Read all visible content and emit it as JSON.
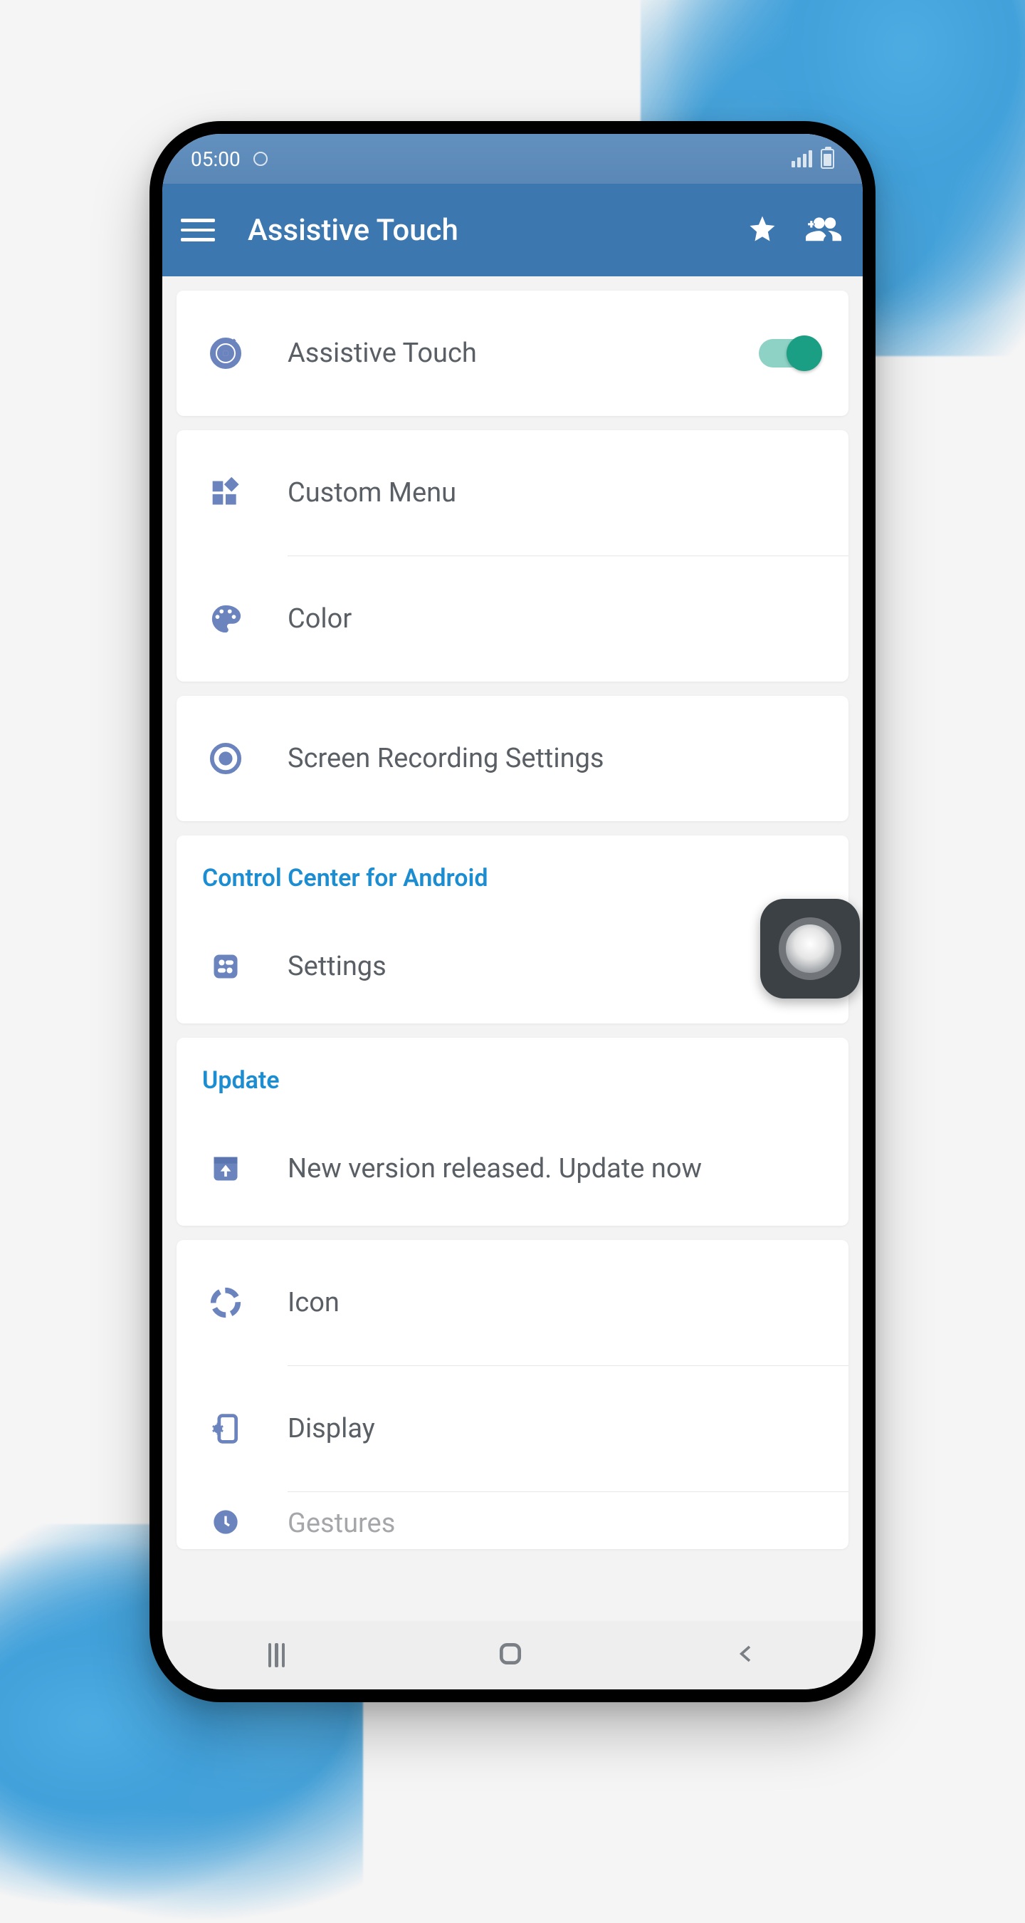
{
  "statusbar": {
    "time": "05:00"
  },
  "appbar": {
    "title": "Assistive Touch"
  },
  "cards": {
    "assistive_toggle": {
      "label": "Assistive Touch",
      "on": true
    },
    "custom_menu": {
      "label": "Custom Menu"
    },
    "color": {
      "label": "Color"
    },
    "screen_recording": {
      "label": "Screen Recording Settings"
    },
    "control_center_section": {
      "title": "Control Center for Android"
    },
    "settings": {
      "label": "Settings"
    },
    "update_section": {
      "title": "Update"
    },
    "update_row": {
      "label": "New version released. Update now"
    },
    "icon": {
      "label": "Icon"
    },
    "display": {
      "label": "Display"
    },
    "gestures": {
      "label": "Gestures"
    }
  }
}
